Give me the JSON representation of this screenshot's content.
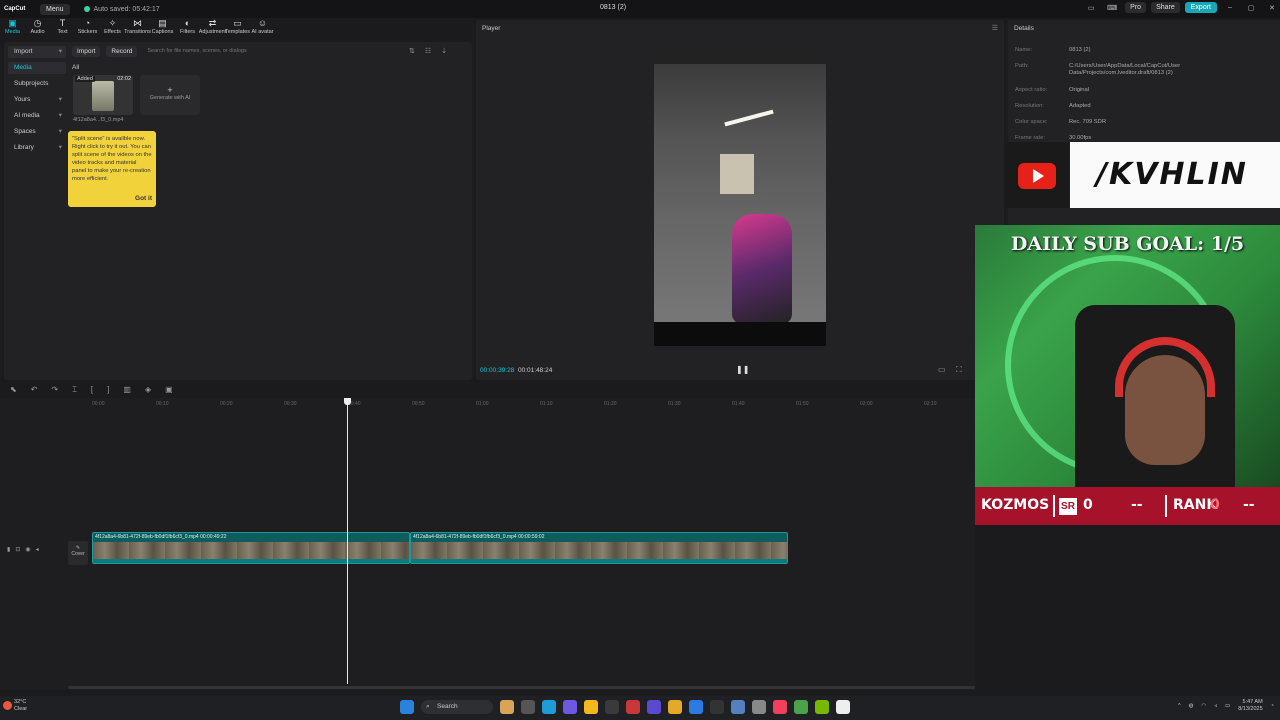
{
  "titlebar": {
    "logo": "CapCut",
    "menu": "Menu",
    "autosave": "Auto saved: 05:42:17",
    "project": "0813 (2)",
    "pro": "Pro",
    "share": "Share",
    "export": "Export"
  },
  "toolbar": {
    "items": [
      {
        "label": "Media",
        "icon": "▣",
        "active": true
      },
      {
        "label": "Audio",
        "icon": "◷"
      },
      {
        "label": "Text",
        "icon": "T"
      },
      {
        "label": "Stickers",
        "icon": "◔"
      },
      {
        "label": "Effects",
        "icon": "✧"
      },
      {
        "label": "Transitions",
        "icon": "⋈"
      },
      {
        "label": "Captions",
        "icon": "▤"
      },
      {
        "label": "Filters",
        "icon": "◐"
      },
      {
        "label": "Adjustment",
        "icon": "⇄"
      },
      {
        "label": "Templates",
        "icon": "▭"
      },
      {
        "label": "AI avatar",
        "icon": "☺"
      }
    ]
  },
  "left_panel": {
    "nav": [
      {
        "label": "Import",
        "head": true
      },
      {
        "label": "Media",
        "selected": true
      },
      {
        "label": "Subprojects"
      },
      {
        "label": "Yours"
      },
      {
        "label": "AI media"
      },
      {
        "label": "Spaces"
      },
      {
        "label": "Library"
      }
    ],
    "import_btn": "Import",
    "record_btn": "Record",
    "search_placeholder": "Search for file names, scenes, or dialogs",
    "all_label": "All",
    "media_item": {
      "added": "Added",
      "duration": "02:02",
      "name": "4f12a8a4...f3_0.mp4"
    },
    "generate_label": "Generate with AI",
    "tip": {
      "text": "\"Split scene\" is availble now. Right click to try it out. You can split scene of the videos on the video tracks and material panel to make your re-creation more efficient.",
      "action": "Got it"
    }
  },
  "player": {
    "title": "Player",
    "current_time": "00:00:39:28",
    "total_time": "00:01:48:24"
  },
  "details": {
    "title": "Details",
    "rows": [
      {
        "label": "Name:",
        "value": "0813 (2)"
      },
      {
        "label": "Path:",
        "value": "C:/Users/User/AppData/Local/CapCut/User Data/Projects/com.lveditor.draft/0813 (2)"
      },
      {
        "label": "Aspect ratio:",
        "value": "Original"
      },
      {
        "label": "Resolution:",
        "value": "Adapted"
      },
      {
        "label": "Color space:",
        "value": "Rec. 709 SDR"
      },
      {
        "label": "Frame rate:",
        "value": "30.00fps"
      }
    ]
  },
  "overlay": {
    "channel": "/KVHLIN",
    "sub_goal": "DAILY SUB GOAL: 1/5",
    "player_name": "KOZMOS",
    "sr_label": "SR",
    "sr_value": "0",
    "sr_dash": "--",
    "rank_label": "RANK",
    "rank_value": "0",
    "rank_dash": "--"
  },
  "timeline": {
    "ticks": [
      "00:00",
      "00:10",
      "00:20",
      "00:30",
      "00:40",
      "00:50",
      "01:00",
      "01:10",
      "01:20",
      "01:30",
      "01:40",
      "01:50",
      "02:00",
      "02:10"
    ],
    "cover_label": "Cover",
    "clips": [
      {
        "label": "4f12a8a4-6b81-472f-89eb-fb0df1fb6cf3_0.mp4  00:00:49:22"
      },
      {
        "label": "4f12a8a4-6b81-472f-89eb-fb0df1fb6cf3_0.mp4  00:00:59:02"
      }
    ]
  },
  "taskbar": {
    "temp": "32°C",
    "weather": "Clear",
    "search": "Search",
    "time": "5:47 AM",
    "date": "8/13/2025"
  }
}
